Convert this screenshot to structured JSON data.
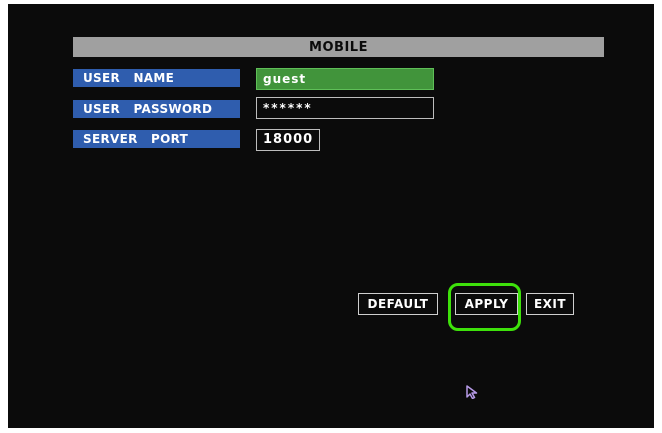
{
  "panel": {
    "title": "MOBILE"
  },
  "fields": {
    "user_name": {
      "label": "USER   NAME",
      "value": "guest"
    },
    "user_password": {
      "label": "USER   PASSWORD",
      "value": "******"
    },
    "server_port": {
      "label": "SERVER   PORT",
      "value": "18000"
    }
  },
  "buttons": {
    "default_label": "DEFAULT",
    "apply_label": "APPLY",
    "exit_label": "EXIT"
  },
  "colors": {
    "screen_background": "#0b0b0b",
    "title_bar": "#a0a0a0",
    "label_background": "#2f5dae",
    "selected_field": "#41943b",
    "highlight_outline": "#3ee10b",
    "cursor": "#b79be8"
  },
  "icons": {
    "cursor": "mouse-pointer-icon"
  }
}
